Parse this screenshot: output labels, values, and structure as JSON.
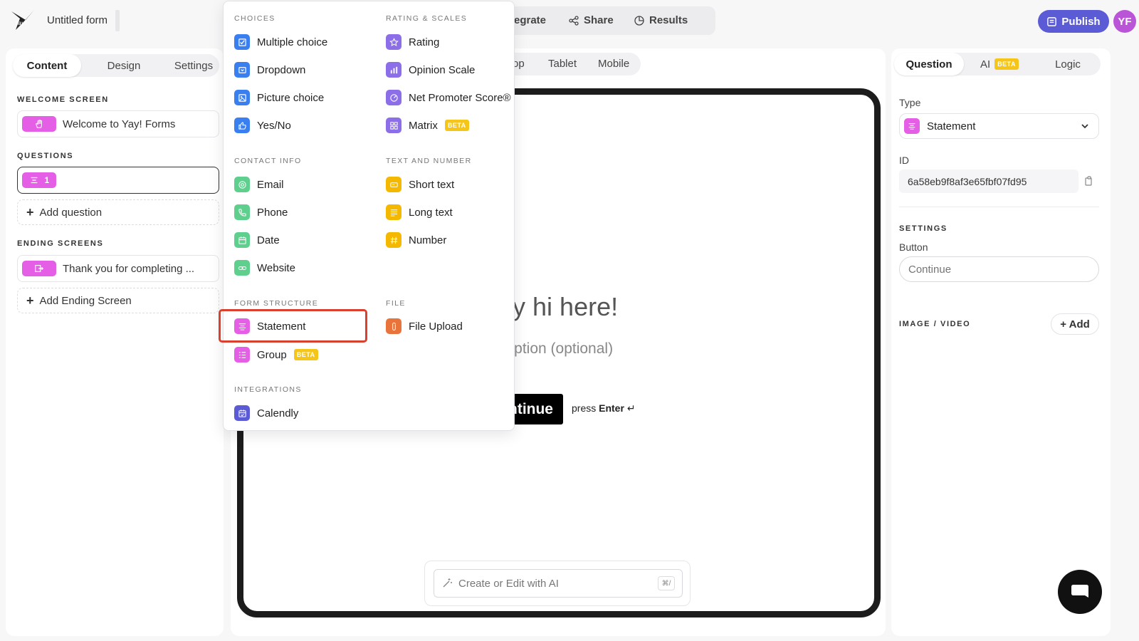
{
  "header": {
    "form_title": "Untitled form",
    "nav": [
      {
        "label": "egrate",
        "icon": "integrate-icon"
      },
      {
        "label": "Share",
        "icon": "share-icon"
      },
      {
        "label": "Results",
        "icon": "results-icon"
      }
    ],
    "publish_label": "Publish",
    "avatar_initials": "YF"
  },
  "left_panel": {
    "tabs": [
      "Content",
      "Design",
      "Settings"
    ],
    "active_tab": "Content",
    "welcome_label": "WELCOME SCREEN",
    "welcome_item": "Welcome to Yay! Forms",
    "questions_label": "QUESTIONS",
    "question_number": "1",
    "add_question": "Add question",
    "ending_label": "ENDING SCREENS",
    "ending_item": "Thank you for completing ...",
    "add_ending": "Add Ending Screen"
  },
  "menu": {
    "choices_label": "CHOICES",
    "choices": [
      "Multiple choice",
      "Dropdown",
      "Picture choice",
      "Yes/No"
    ],
    "rating_label": "RATING & SCALES",
    "rating": [
      "Rating",
      "Opinion Scale",
      "Net Promoter Score®",
      "Matrix"
    ],
    "contact_label": "CONTACT INFO",
    "contact": [
      "Email",
      "Phone",
      "Date",
      "Website"
    ],
    "text_label": "TEXT AND NUMBER",
    "text": [
      "Short text",
      "Long text",
      "Number"
    ],
    "structure_label": "FORM STRUCTURE",
    "structure": [
      "Statement",
      "Group"
    ],
    "file_label": "FILE",
    "file": [
      "File Upload"
    ],
    "integrations_label": "INTEGRATIONS",
    "integrations": [
      "Calendly"
    ],
    "beta": "BETA"
  },
  "preview": {
    "device_tabs": [
      "op",
      "Tablet",
      "Mobile"
    ],
    "hero": "ay hi here!",
    "description": "cription (optional)",
    "continue": "ntinue",
    "press": "press ",
    "enter": "Enter",
    "enter_symbol": "↵",
    "ai_placeholder": "Create or Edit with AI",
    "ai_shortcut": "⌘/"
  },
  "right_panel": {
    "tabs": [
      "Question",
      "AI",
      "Logic"
    ],
    "ai_badge": "BETA",
    "type_label": "Type",
    "type_value": "Statement",
    "id_label": "ID",
    "id_value": "6a58eb9f8af3e65fbf07fd95",
    "settings_label": "SETTINGS",
    "button_label": "Button",
    "button_placeholder": "Continue",
    "image_video_label": "IMAGE / VIDEO",
    "add_label": "+ Add"
  },
  "colors": {
    "accent": "#5b5bd6",
    "statement_pink": "#e45ee6",
    "choices_blue": "#3a7ff0",
    "rating_purple": "#8b6ee8",
    "contact_green": "#5fcf8e",
    "text_yellow": "#f5b800",
    "file_orange": "#e8743b",
    "highlight_red": "#d9412e"
  }
}
